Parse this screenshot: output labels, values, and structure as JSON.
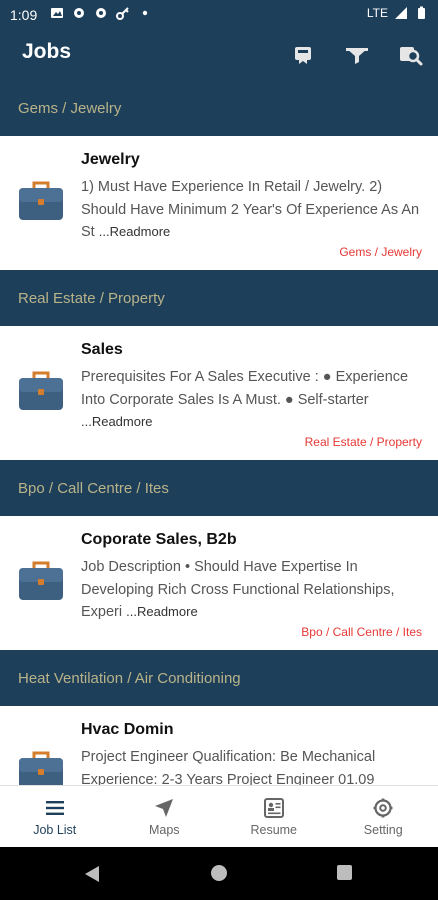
{
  "status_bar": {
    "time": "1:09",
    "network": "LTE"
  },
  "app_bar": {
    "title": "Jobs"
  },
  "jobs": [
    {
      "section": "Gems / Jewelry",
      "title": "Jewelry",
      "description": "1) Must Have Experience In Retail / Jewelry. 2) Should Have Minimum 2 Year's Of Experience As An St",
      "readmore": "...Readmore",
      "category": "Gems / Jewelry"
    },
    {
      "section": "Real Estate / Property",
      "title": "Sales",
      "description": "Prerequisites For A Sales Executive : ● Experience Into Corporate Sales Is A Must. ● Self-starter",
      "readmore": "...Readmore",
      "category": "Real Estate / Property"
    },
    {
      "section": "Bpo / Call Centre / Ites",
      "title": "Coporate Sales, B2b",
      "description": "Job Description  • Should Have Expertise In Developing Rich Cross Functional Relationships, Experi",
      "readmore": "...Readmore",
      "category": "Bpo / Call Centre / Ites"
    },
    {
      "section": "Heat Ventilation / Air Conditioning",
      "title": "Hvac Domin",
      "description": "Project Engineer  Qualification: Be Mechanical Experience: 2-3 Years  Project Engineer 01.09",
      "readmore": "",
      "category": ""
    }
  ],
  "bottom_nav": [
    {
      "label": "Job List",
      "icon": "list-icon",
      "active": true
    },
    {
      "label": "Maps",
      "icon": "navigation-arrow-icon",
      "active": false
    },
    {
      "label": "Resume",
      "icon": "resume-icon",
      "active": false
    },
    {
      "label": "Setting",
      "icon": "gear-icon",
      "active": false
    }
  ],
  "colors": {
    "primary": "#1e3f5a",
    "section_text": "#b8b389",
    "category_text": "#e53935",
    "bag_body": "#3d5f80",
    "bag_handle": "#d37d2d"
  }
}
